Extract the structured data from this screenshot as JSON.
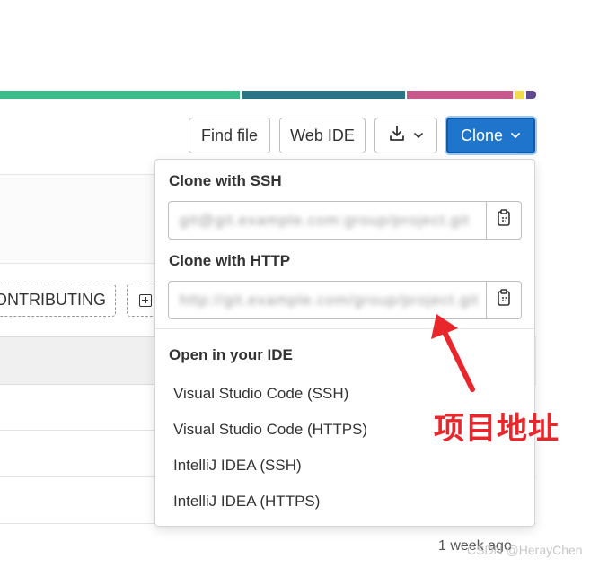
{
  "language_bar": {
    "segments": [
      {
        "color": "#3dbb8a",
        "fraction": 0.449
      },
      {
        "color": "#2a7486",
        "fraction": 0.305
      },
      {
        "color": "#c7598c",
        "fraction": 0.2
      },
      {
        "color": "#f1da4e",
        "fraction": 0.02
      },
      {
        "color": "#5e4a8c",
        "fraction": 0.026
      }
    ]
  },
  "toolbar": {
    "find_file": "Find file",
    "web_ide": "Web IDE",
    "download_icon": "download-icon",
    "clone": "Clone",
    "accent_color": "#1f75cb"
  },
  "page": {
    "contributing_label": "CONTRIBUTING",
    "last_update": "1 week ago"
  },
  "clone_dropdown": {
    "ssh_title": "Clone with SSH",
    "ssh_url": "git@git.example.com:group/project.git",
    "http_title": "Clone with HTTP",
    "http_url": "http://git.example.com/group/project.git",
    "ide_title": "Open in your IDE",
    "ide_options": [
      "Visual Studio Code (SSH)",
      "Visual Studio Code (HTTPS)",
      "IntelliJ IDEA (SSH)",
      "IntelliJ IDEA (HTTPS)"
    ]
  },
  "annotation": {
    "text": "项目地址",
    "color": "#e8262b"
  },
  "watermark": "CSDN @HerayChen"
}
